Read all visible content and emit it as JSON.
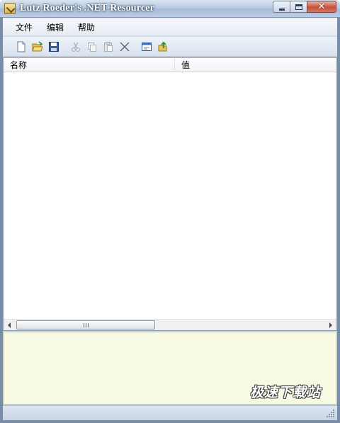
{
  "window": {
    "title": "Lutz Roeder's .NET Resourcer",
    "caption_buttons": [
      "minimize",
      "maximize",
      "close"
    ]
  },
  "menu": {
    "items": [
      "文件",
      "编辑",
      "帮助"
    ]
  },
  "toolbar": {
    "buttons": [
      {
        "icon": "new-file-icon",
        "enabled": true
      },
      {
        "icon": "open-folder-icon",
        "enabled": true
      },
      {
        "icon": "save-icon",
        "enabled": true
      },
      {
        "icon": "cut-icon",
        "enabled": false
      },
      {
        "icon": "copy-icon",
        "enabled": false
      },
      {
        "icon": "paste-icon",
        "enabled": false
      },
      {
        "icon": "delete-icon",
        "enabled": false
      },
      {
        "icon": "properties-icon",
        "enabled": true
      },
      {
        "icon": "export-icon",
        "enabled": true
      }
    ]
  },
  "list": {
    "columns": [
      "名称",
      "值"
    ],
    "rows": []
  },
  "preview": {
    "watermark": "极速下载站"
  },
  "colors": {
    "preview_background": "#f8f9e2",
    "titlebar": "#b9cbe1",
    "close_button": "#c8503a"
  }
}
